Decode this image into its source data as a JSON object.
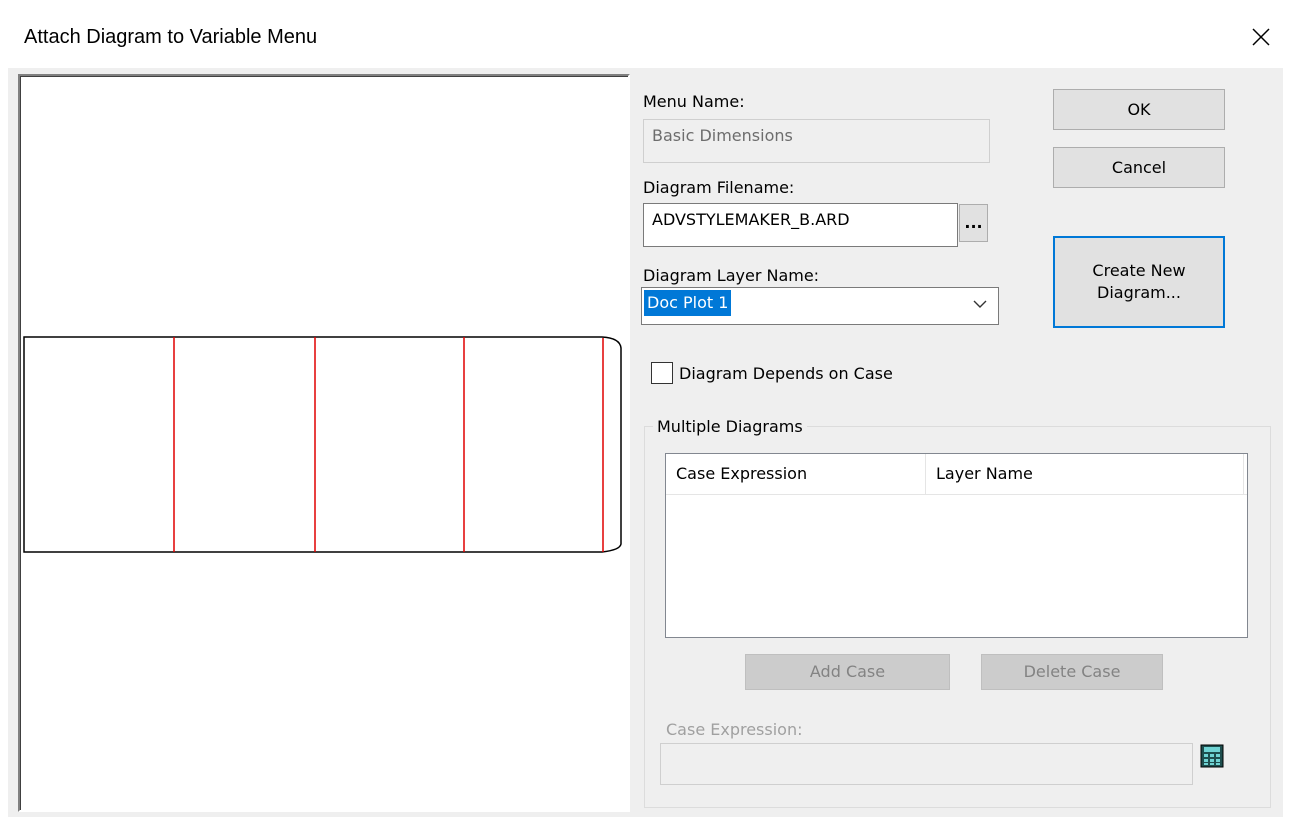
{
  "window": {
    "title": "Attach Diagram to Variable Menu"
  },
  "icons": {
    "close": "close-icon",
    "dropdown": "chevron-down-icon",
    "calculator": "calculator-icon"
  },
  "colors": {
    "accent": "#0078d7",
    "diagram_line": "#e00000"
  },
  "form": {
    "menu_name_label": "Menu Name:",
    "menu_name_value": "Basic Dimensions",
    "diagram_filename_label": "Diagram Filename:",
    "diagram_filename_value": "ADVSTYLEMAKER_B.ARD",
    "browse_label": "...",
    "diagram_layer_label": "Diagram Layer Name:",
    "diagram_layer_value": "Doc Plot 1",
    "depends_on_case_label": "Diagram Depends on Case",
    "depends_on_case_checked": false
  },
  "buttons": {
    "ok": "OK",
    "cancel": "Cancel",
    "create_new_line1": "Create New",
    "create_new_line2": "Diagram..."
  },
  "multiple": {
    "group_title": "Multiple Diagrams",
    "columns": [
      "Case Expression",
      "Layer Name"
    ],
    "rows": [],
    "add_case": "Add Case",
    "delete_case": "Delete Case",
    "case_expression_label": "Case Expression:",
    "case_expression_value": ""
  }
}
